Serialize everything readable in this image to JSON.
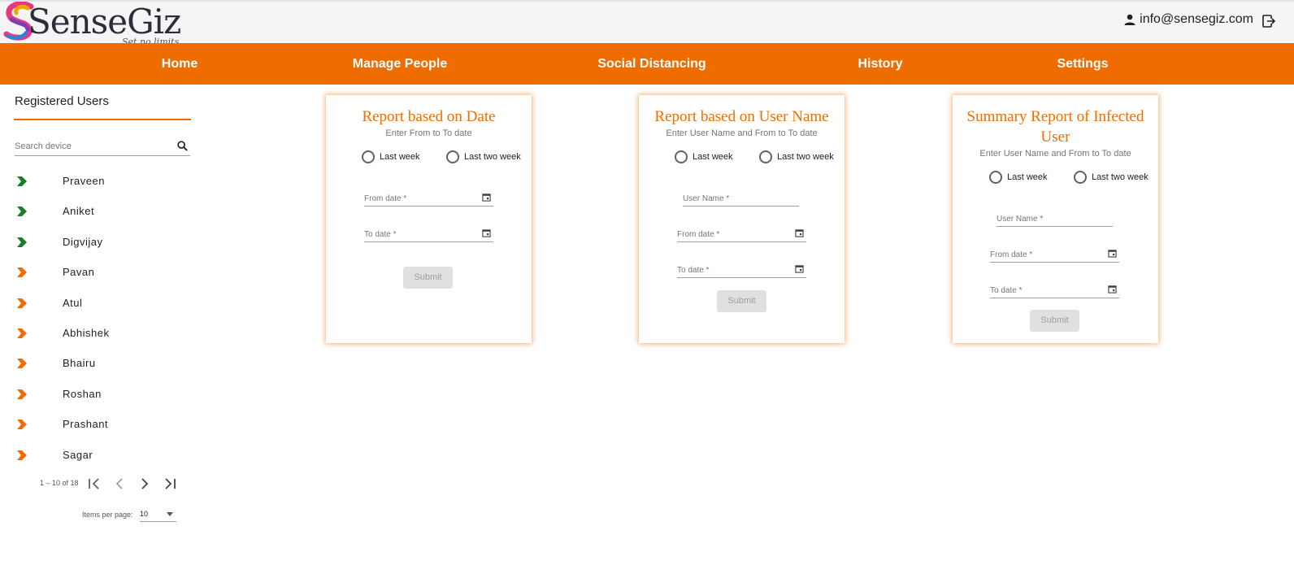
{
  "brand": {
    "logo_text": "SenseGiz",
    "tagline": "Set no limits."
  },
  "header": {
    "user_email": "info@sensegiz.com",
    "user_icon": "person-icon",
    "logout_icon": "logout-icon"
  },
  "nav": {
    "items": [
      {
        "label": "Home"
      },
      {
        "label": "Manage People"
      },
      {
        "label": "Social Distancing"
      },
      {
        "label": "History"
      },
      {
        "label": "Settings"
      }
    ]
  },
  "sidebar": {
    "title": "Registered Users",
    "search_placeholder": "Search device",
    "users": [
      {
        "name": "Praveen",
        "status_color": "#1b7d2a"
      },
      {
        "name": "Aniket",
        "status_color": "#1b7d2a"
      },
      {
        "name": "Digvijay",
        "status_color": "#1b7d2a"
      },
      {
        "name": "Pavan",
        "status_color": "#ef6c00"
      },
      {
        "name": "Atul",
        "status_color": "#ef6c00"
      },
      {
        "name": "Abhishek",
        "status_color": "#ef6c00"
      },
      {
        "name": "Bhairu",
        "status_color": "#ef6c00"
      },
      {
        "name": "Roshan",
        "status_color": "#ef6c00"
      },
      {
        "name": "Prashant",
        "status_color": "#ef6c00"
      },
      {
        "name": "Sagar",
        "status_color": "#ef6c00"
      }
    ],
    "paginator": {
      "range_label": "1 – 10 of 18",
      "items_per_page_label": "Items per page:",
      "items_per_page_value": "10"
    }
  },
  "cards": [
    {
      "title": "Report based on Date",
      "subtitle": "Enter From to To date",
      "radio_last_week": "Last week",
      "radio_last_two_week": "Last two week",
      "from_date_placeholder": "From date *",
      "to_date_placeholder": "To date *",
      "submit_label": "Submit"
    },
    {
      "title": "Report based on User Name",
      "subtitle": "Enter User Name and From to To date",
      "radio_last_week": "Last week",
      "radio_last_two_week": "Last two week",
      "user_name_placeholder": "User Name *",
      "from_date_placeholder": "From date *",
      "to_date_placeholder": "To date *",
      "submit_label": "Submit"
    },
    {
      "title": "Summary Report of Infected User",
      "subtitle": "Enter User Name and From to To date",
      "radio_last_week": "Last week",
      "radio_last_two_week": "Last two week",
      "user_name_placeholder": "User Name *",
      "from_date_placeholder": "From date *",
      "to_date_placeholder": "To date *",
      "submit_label": "Submit"
    }
  ],
  "colors": {
    "accent": "#ef6c00",
    "online": "#1b7d2a"
  }
}
